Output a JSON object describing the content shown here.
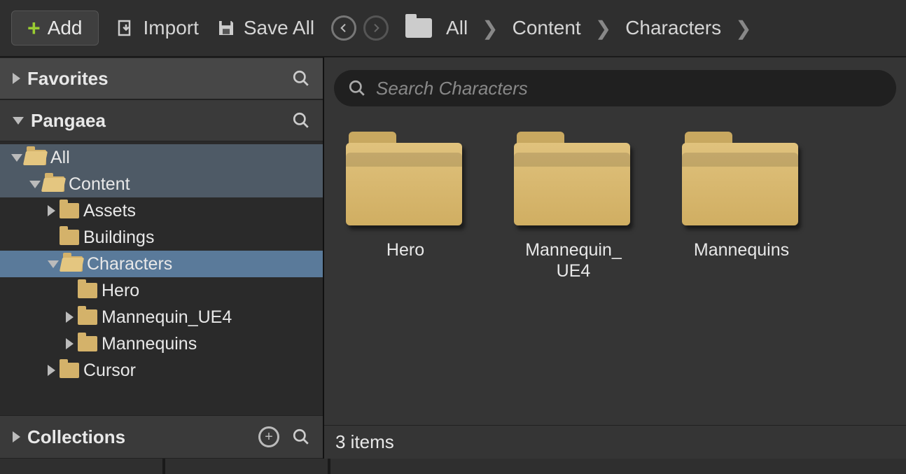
{
  "toolbar": {
    "add_label": "Add",
    "import_label": "Import",
    "save_all_label": "Save All"
  },
  "breadcrumb": {
    "root": "All",
    "items": [
      "Content",
      "Characters"
    ]
  },
  "sidebar": {
    "favorites_label": "Favorites",
    "project_label": "Pangaea",
    "collections_label": "Collections",
    "tree": [
      {
        "label": "All",
        "depth": 0,
        "expanded": true,
        "open": true,
        "highlight": true,
        "selected": false
      },
      {
        "label": "Content",
        "depth": 1,
        "expanded": true,
        "open": true,
        "highlight": true,
        "selected": false
      },
      {
        "label": "Assets",
        "depth": 2,
        "expanded": false,
        "open": false,
        "highlight": false,
        "selected": false,
        "arrow": true
      },
      {
        "label": "Buildings",
        "depth": 2,
        "expanded": false,
        "open": false,
        "highlight": false,
        "selected": false,
        "arrow": false
      },
      {
        "label": "Characters",
        "depth": 2,
        "expanded": true,
        "open": true,
        "highlight": false,
        "selected": true
      },
      {
        "label": "Hero",
        "depth": 3,
        "expanded": false,
        "open": false,
        "highlight": false,
        "selected": false,
        "arrow": false
      },
      {
        "label": "Mannequin_UE4",
        "depth": 3,
        "expanded": false,
        "open": false,
        "highlight": false,
        "selected": false,
        "arrow": true
      },
      {
        "label": "Mannequins",
        "depth": 3,
        "expanded": false,
        "open": false,
        "highlight": false,
        "selected": false,
        "arrow": true
      },
      {
        "label": "Cursor",
        "depth": 2,
        "expanded": false,
        "open": false,
        "highlight": false,
        "selected": false,
        "arrow": true
      }
    ]
  },
  "content": {
    "search_placeholder": "Search Characters",
    "items": [
      {
        "label": "Hero"
      },
      {
        "label": "Mannequin_\nUE4"
      },
      {
        "label": "Mannequins"
      }
    ],
    "status": "3 items"
  }
}
